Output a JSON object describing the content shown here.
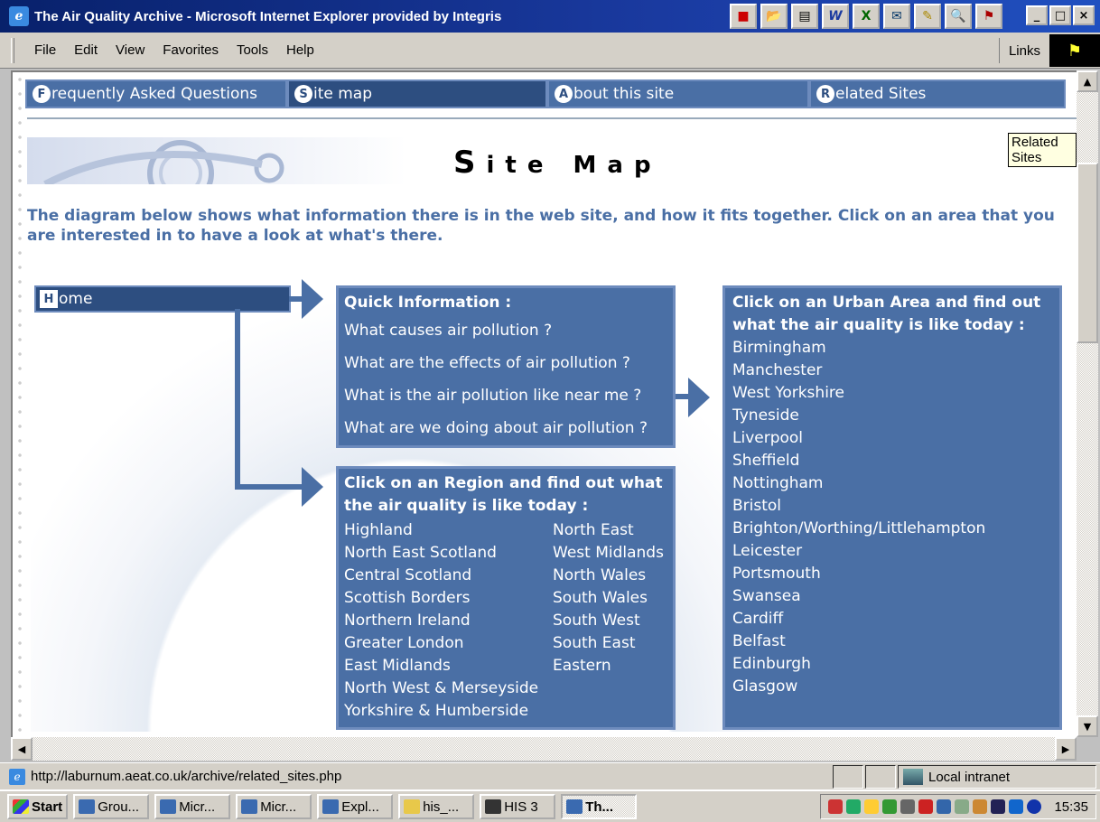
{
  "window": {
    "title": "The Air Quality Archive - Microsoft Internet Explorer provided by Integris",
    "controls": [
      "_",
      "□",
      "×"
    ]
  },
  "menubar": {
    "items": [
      "File",
      "Edit",
      "View",
      "Favorites",
      "Tools",
      "Help"
    ],
    "links_label": "Links"
  },
  "nav": {
    "tabs": [
      {
        "cap": "F",
        "label": "requently Asked Questions"
      },
      {
        "cap": "S",
        "label": "ite map"
      },
      {
        "cap": "A",
        "label": "bout this site"
      },
      {
        "cap": "R",
        "label": "elated Sites"
      }
    ],
    "tooltip": "Related Sites"
  },
  "page": {
    "title_first": "S",
    "title_rest": "ite Map",
    "intro": "The diagram below shows what information there is in the web site, and how it fits together. Click on an area that you are interested in to have a look at what's there.",
    "home_cap": "H",
    "home_label": "ome"
  },
  "quick_info": {
    "heading": "Quick Information :",
    "links": [
      "What causes air pollution ?",
      "What are the effects of air pollution ?",
      "What is the air pollution like near me ?",
      "What are we doing about air pollution ?"
    ]
  },
  "regions": {
    "heading": "Click on an Region and find out what the air quality is like today :",
    "col1": [
      "Highland",
      "North East Scotland",
      "Central Scotland",
      "Scottish Borders",
      "Northern Ireland",
      "Greater London",
      "East Midlands",
      "North West & Merseyside",
      "Yorkshire & Humberside"
    ],
    "col2": [
      "North East",
      "West Midlands",
      "North Wales",
      "South Wales",
      "South West",
      "South East",
      "Eastern"
    ]
  },
  "urban": {
    "heading": "Click on an Urban Area and find out what the air quality is like today :",
    "areas": [
      "Birmingham",
      "Manchester",
      "West Yorkshire",
      "Tyneside",
      "Liverpool",
      "Sheffield",
      "Nottingham",
      "Bristol",
      "Brighton/Worthing/Littlehampton",
      "Leicester",
      "Portsmouth",
      "Swansea",
      "Cardiff",
      "Belfast",
      "Edinburgh",
      "Glasgow"
    ]
  },
  "status": {
    "url": "http://laburnum.aeat.co.uk/archive/related_sites.php",
    "zone": "Local intranet"
  },
  "taskbar": {
    "start": "Start",
    "tasks": [
      "Grou...",
      "Micr...",
      "Micr...",
      "Expl...",
      "his_...",
      "HIS 3",
      "Th..."
    ],
    "clock": "15:35"
  },
  "colors": {
    "panel": "#4a6fa5",
    "panel_dark": "#2d4e80",
    "title_bar": "#08216b",
    "chrome": "#d4d0c8"
  }
}
